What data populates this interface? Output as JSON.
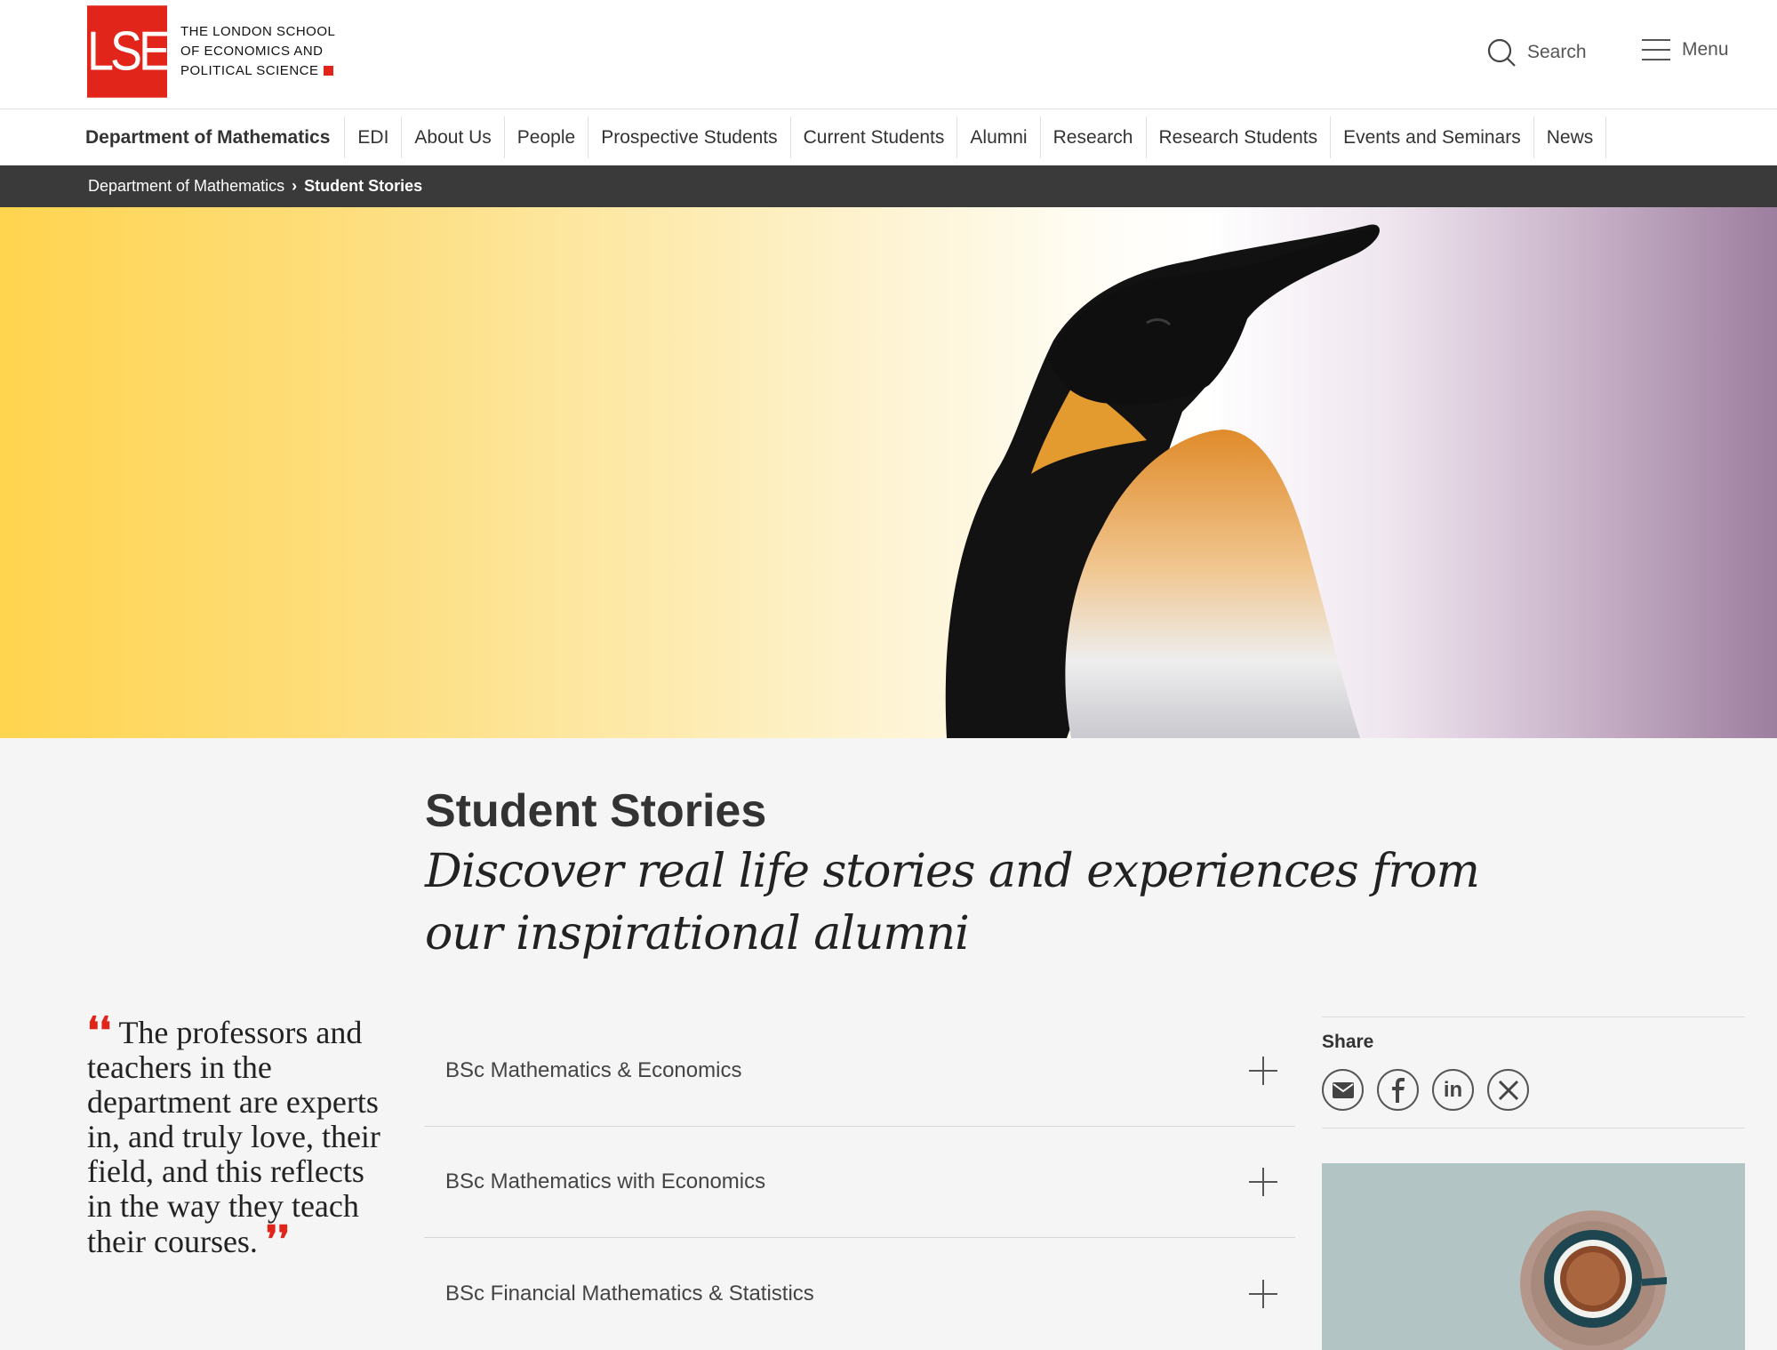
{
  "header": {
    "logo_mark": "LSE",
    "logo_line1": "THE LONDON SCHOOL",
    "logo_line2": "OF ECONOMICS AND",
    "logo_line3": "POLITICAL SCIENCE",
    "search_label": "Search",
    "menu_label": "Menu"
  },
  "nav": {
    "home": "Department of Mathematics",
    "items": [
      "EDI",
      "About Us",
      "People",
      "Prospective Students",
      "Current Students",
      "Alumni",
      "Research",
      "Research Students",
      "Events and Seminars",
      "News"
    ]
  },
  "breadcrumb": {
    "parent": "Department of Mathematics",
    "separator": "›",
    "current": "Student Stories"
  },
  "page": {
    "title": "Student Stories",
    "subtitle": "Discover real life stories and experiences from our inspirational alumni"
  },
  "quote": {
    "open_mark": "❛❛",
    "text": "The professors and teachers in the department are experts in, and truly love, their field, and this reflects in the way they teach their courses.",
    "close_mark": "❜❜"
  },
  "accordion": [
    {
      "label": "BSc Mathematics & Economics"
    },
    {
      "label": "BSc Mathematics with Economics"
    },
    {
      "label": "BSc Financial Mathematics & Statistics"
    }
  ],
  "share": {
    "label": "Share",
    "icons": [
      "email-icon",
      "facebook-icon",
      "linkedin-icon",
      "x-icon"
    ],
    "linkedin_text": "in"
  },
  "colors": {
    "brand_red": "#e1251b",
    "breadcrumb_bg": "#3a3a3a",
    "hero_yellow": "#ffd44e",
    "hero_purple": "#9c7e9e"
  }
}
